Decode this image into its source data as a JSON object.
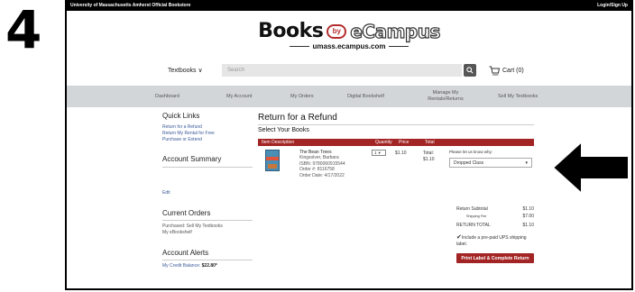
{
  "step_number": "4",
  "topbar": {
    "store_name": "University of Massachusetts Amherst Official Bookstore",
    "login": "Login/Sign Up"
  },
  "logo": {
    "books": "Books",
    "by": "by",
    "ecampus": "eCampus",
    "domain": "umass.ecampus.com"
  },
  "search": {
    "category": "Textbooks",
    "placeholder": "Search"
  },
  "cart": {
    "label": "Cart (0)"
  },
  "nav": {
    "items": [
      "Dashboard",
      "My Account",
      "My Orders",
      "Digital Bookshelf",
      "Manage My",
      "Rentals/Returns",
      "Sell My Textbooks"
    ]
  },
  "sidebar": {
    "quick_links_title": "Quick Links",
    "quick_links": [
      "Return for a Refund",
      "Return My Rental for Free",
      "Purchase or Extend"
    ],
    "account_summary_title": "Account Summary",
    "edit_label": "Edit",
    "current_orders_title": "Current Orders",
    "current_orders": [
      "Purchased: Sell My Textbooks",
      "My eBookshelf"
    ],
    "account_alerts_title": "Account Alerts",
    "credit_label": "My Credit Balance:",
    "credit_value": "$22.80*"
  },
  "main": {
    "title": "Return for a Refund",
    "subtitle": "Select Your Books",
    "columns": {
      "description": "Item Description",
      "quantity": "Quantity",
      "price": "Price",
      "total": "Total"
    },
    "book": {
      "title": "The Bean Trees",
      "author": "Kingsolver, Barbara",
      "isbn": "ISBN: 9780060915544",
      "order": "Order #: 8116758",
      "order_date": "Order Date: 4/17/2022",
      "quantity": "1",
      "price": "$1.10",
      "total_label": "Total:",
      "total_value": "$1.10"
    },
    "why_label": "Please let us know why:",
    "reason": "Dropped Class",
    "summary": {
      "subtotal_label": "Return Subtotal",
      "subtotal_value": "$1.10",
      "shipping_label": "Shipping Fee",
      "shipping_value": "$7.00",
      "total_label": "RETURN TOTAL",
      "total_value": "$1.10"
    },
    "ups_label": "Include a pre-paid UPS shipping label.",
    "print_button": "Print Label & Complete Return"
  }
}
